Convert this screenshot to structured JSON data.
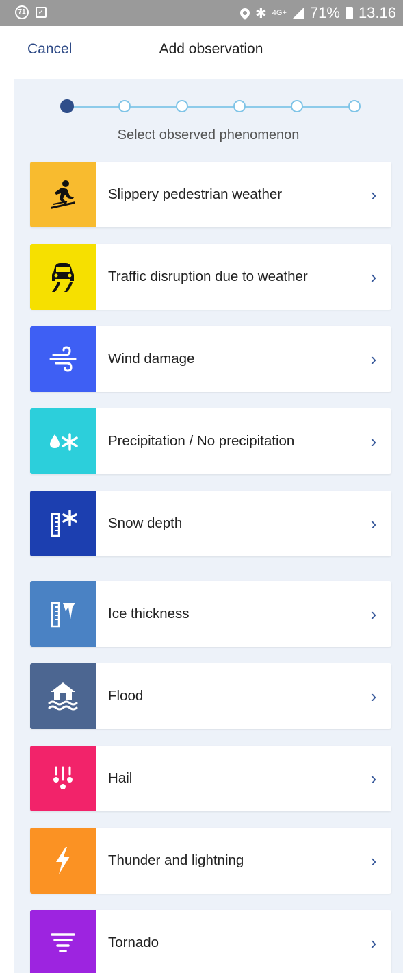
{
  "statusbar": {
    "left_badge": "71",
    "network": "4G+",
    "battery": "71%",
    "time": "13.16"
  },
  "header": {
    "cancel_label": "Cancel",
    "title": "Add observation"
  },
  "stepper": {
    "steps_total": 6,
    "active_step": 1,
    "label": "Select observed phenomenon"
  },
  "items": [
    {
      "label": "Slippery pedestrian weather",
      "icon": "slipping-person-icon",
      "color": "#f8bb2f"
    },
    {
      "label": "Traffic disruption due to weather",
      "icon": "car-skid-icon",
      "color": "#f6e000"
    },
    {
      "label": "Wind damage",
      "icon": "wind-icon",
      "color": "#3e5ff4"
    },
    {
      "label": "Precipitation / No precipitation",
      "icon": "drop-snowflake-icon",
      "color": "#2ccfdb"
    },
    {
      "label": "Snow depth",
      "icon": "ruler-snowflake-icon",
      "color": "#1c3fb0"
    },
    {
      "label": "Ice thickness",
      "icon": "ruler-icicle-icon",
      "color": "#4a82c4"
    },
    {
      "label": "Flood",
      "icon": "flooded-house-icon",
      "color": "#4c6691"
    },
    {
      "label": "Hail",
      "icon": "hail-icon",
      "color": "#f2236a"
    },
    {
      "label": "Thunder and lightning",
      "icon": "lightning-icon",
      "color": "#fb9223"
    },
    {
      "label": "Tornado",
      "icon": "tornado-icon",
      "color": "#9d24e0"
    }
  ],
  "chevron": "›"
}
